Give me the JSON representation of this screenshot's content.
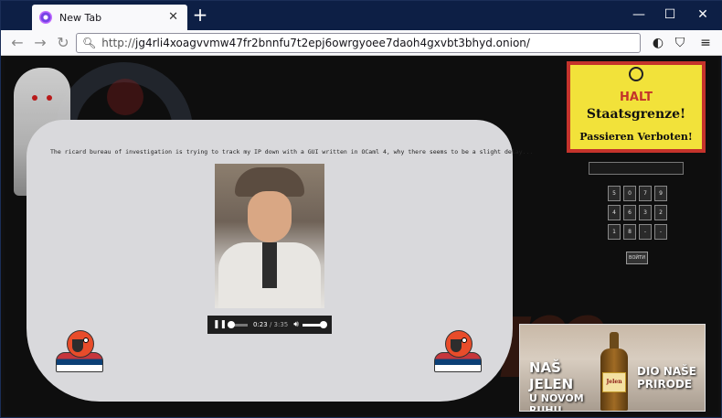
{
  "browser": {
    "tab_title": "New Tab",
    "tab_close": "✕",
    "new_tab": "+",
    "url_proto": "http://",
    "url_host": "jg4rli4xoagvvmw47fr2bnnfu7t2epj6owrgyoee7daoh4gxvbt3bhyd.onion/",
    "window_minimize": "—",
    "window_maximize": "☐",
    "window_close": "✕"
  },
  "page": {
    "marquee_text": "The ricard bureau of investigation is trying to track my IP down with a GUI written in OCaml 4, why there seems to be a slight delay...",
    "player": {
      "current_time": "0:23",
      "duration": " / 3:35",
      "progress": 0.11,
      "volume": 1.0
    },
    "sign": {
      "line1": "HALT",
      "line2": "Staatsgrenze!",
      "line3": "Passieren Verboten!"
    },
    "pin_value": "",
    "keypad": [
      "5",
      "0",
      "7",
      "9",
      "4",
      "6",
      "3",
      "2",
      "1",
      "8",
      "-",
      "-"
    ],
    "login_label": "ВОЙТИ",
    "ad": {
      "left_l1": "NAŠ JELEN",
      "left_l2": "U NOVOM RUHU",
      "right_l1": "DIO NAŠE",
      "right_l2": "PRIRODE",
      "bottle_label": "Jelen"
    }
  },
  "colors": {
    "titlebar": "#0d1f45",
    "panel": "#d9d9dc",
    "sign_bg": "#f2e23a",
    "sign_border": "#c4332b"
  }
}
